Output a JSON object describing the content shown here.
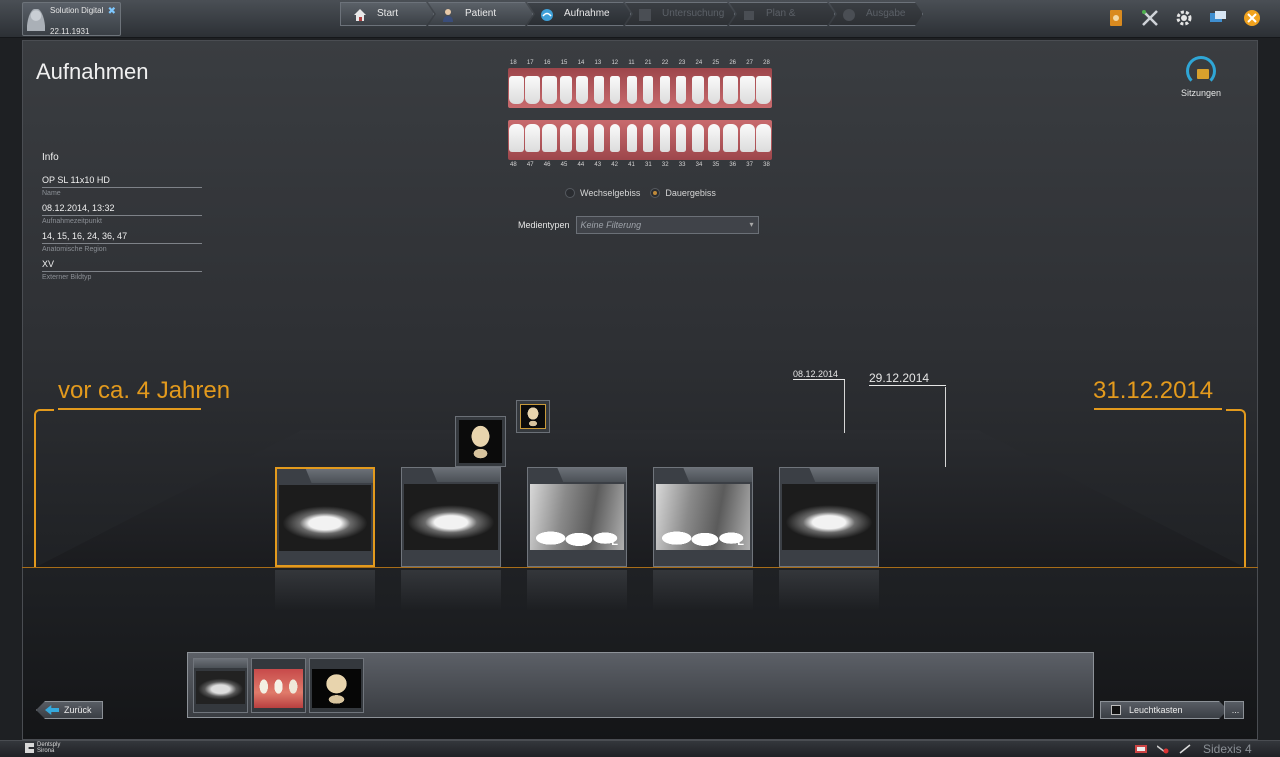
{
  "patient": {
    "name": "Solution Digital",
    "dob": "22.11.1931"
  },
  "workflow": [
    {
      "label": "Start",
      "state": "normal"
    },
    {
      "label": "Patient",
      "state": "normal"
    },
    {
      "label": "Aufnahme",
      "state": "active"
    },
    {
      "label": "Untersuchung",
      "state": "disabled"
    },
    {
      "label": "Plan & Treat",
      "state": "disabled"
    },
    {
      "label": "Ausgabe",
      "state": "disabled"
    }
  ],
  "top_icons": [
    "book-icon",
    "tools-icon",
    "gear-icon",
    "monitor-icon",
    "close-icon"
  ],
  "page": {
    "title": "Aufnahmen",
    "sessions_label": "Sitzungen"
  },
  "info": {
    "heading": "Info",
    "fields": [
      {
        "value": "OP SL 11x10 HD",
        "label": "Name"
      },
      {
        "value": "08.12.2014, 13:32",
        "label": "Aufnahmezeitpunkt"
      },
      {
        "value": "14, 15, 16, 24, 36, 47",
        "label": "Anatomische Region"
      },
      {
        "value": "XV",
        "label": "Externer Bildtyp"
      }
    ]
  },
  "teeth": {
    "upper": [
      "18",
      "17",
      "16",
      "15",
      "14",
      "13",
      "12",
      "11",
      "21",
      "22",
      "23",
      "24",
      "25",
      "26",
      "27",
      "28"
    ],
    "lower": [
      "48",
      "47",
      "46",
      "45",
      "44",
      "43",
      "42",
      "41",
      "31",
      "32",
      "33",
      "34",
      "35",
      "36",
      "37",
      "38"
    ],
    "dentition_options": [
      {
        "label": "Wechselgebiss",
        "selected": false
      },
      {
        "label": "Dauergebiss",
        "selected": true
      }
    ]
  },
  "media_filter": {
    "label": "Medientypen",
    "value": "Keine Filterung"
  },
  "timeline": {
    "start_label": "vor ca. 4 Jahren",
    "end_label": "31.12.2014",
    "date_markers": [
      "08.12.2014",
      "29.12.2014"
    ]
  },
  "colors": {
    "accent": "#e39a1d",
    "blue": "#35a9dd"
  },
  "buttons": {
    "back": "Zurück",
    "lightbox": "Leuchtkasten",
    "more": "..."
  },
  "footer": {
    "brand": "Dentsply Sirona",
    "product": "Sidexis 4"
  }
}
